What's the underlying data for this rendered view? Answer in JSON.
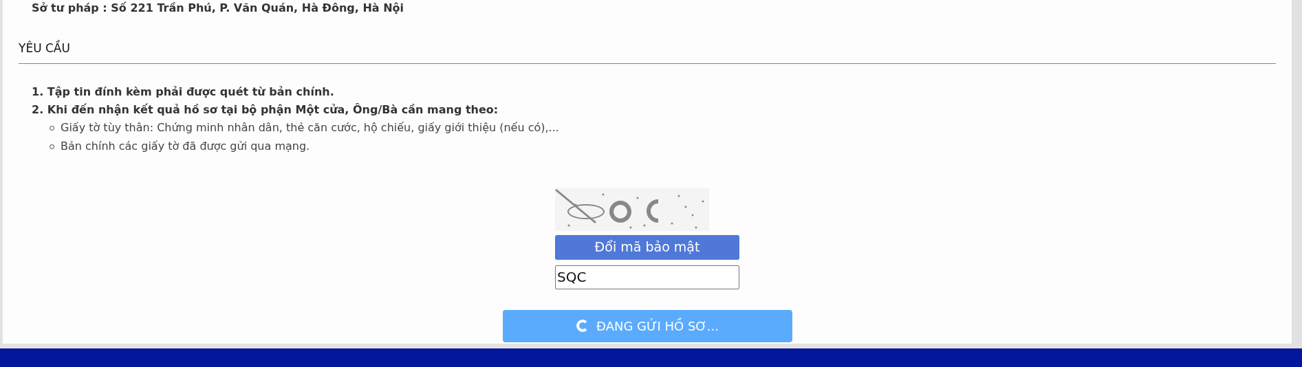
{
  "address_line": "Sở tư pháp : Số 221 Trần Phú, P. Văn Quán, Hà Đông, Hà Nội",
  "section": {
    "title": "YÊU CẦU"
  },
  "requirements": [
    {
      "kind": "numbered",
      "text": "1. Tập tin đính kèm phải được quét từ bản chính."
    },
    {
      "kind": "numbered",
      "text": "2. Khi đến nhận kết quả hồ sơ tại bộ phận Một cửa, Ông/Bà cần mang theo:"
    },
    {
      "kind": "bullet",
      "text": "Giấy tờ tùy thân: Chứng minh nhân dân, thẻ căn cước, hộ chiếu, giấy giới thiệu (nếu có),..."
    },
    {
      "kind": "bullet",
      "text": "Bản chính các giấy tờ đã được gửi qua mạng."
    }
  ],
  "captcha": {
    "refresh_button": "Đổi mã bảo mật",
    "input_value": "SQC"
  },
  "submit_button": {
    "label": "ĐANG GỬI HỒ SƠ...",
    "loading": true
  }
}
